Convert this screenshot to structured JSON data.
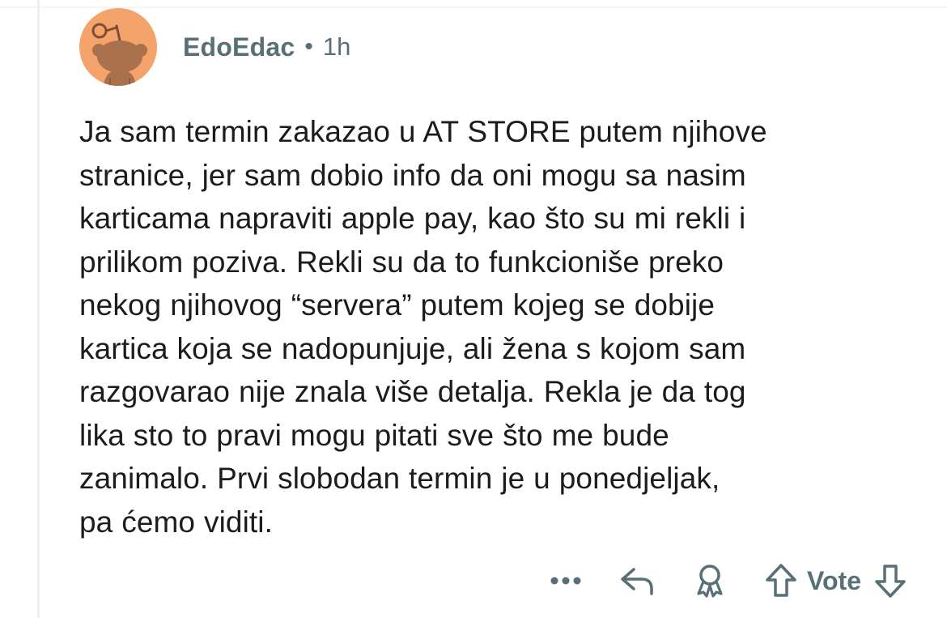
{
  "comment": {
    "username": "EdoEdac",
    "separator": "•",
    "time": "1h",
    "body_lines": [
      "Ja sam termin zakazao u AT STORE putem njihove",
      "stranice, jer sam dobio info da oni mogu sa nasim",
      "karticama napraviti apple pay, kao što su mi rekli i",
      "prilikom poziva. Rekli su da to funkcioniše preko",
      "nekog njihovog “servera” putem kojeg se dobije",
      "kartica koja se nadopunjuje, ali žena s kojom sam",
      "razgovarao nije znala više detalja. Rekla je da tog",
      "lika sto to pravi mogu pitati sve što me bude",
      "zanimalo. Prvi slobodan termin je u ponedjeljak,",
      "pa ćemo viditi."
    ]
  },
  "actions": {
    "more_icon": "more-dots-icon",
    "reply_icon": "reply-arrow-icon",
    "award_icon": "award-icon",
    "upvote_icon": "upvote-arrow-icon",
    "vote_label": "Vote",
    "downvote_icon": "downvote-arrow-icon"
  },
  "colors": {
    "avatar_bg": "#f4a46a",
    "meta_text": "#576f76",
    "body_text": "#1c1c1c"
  }
}
